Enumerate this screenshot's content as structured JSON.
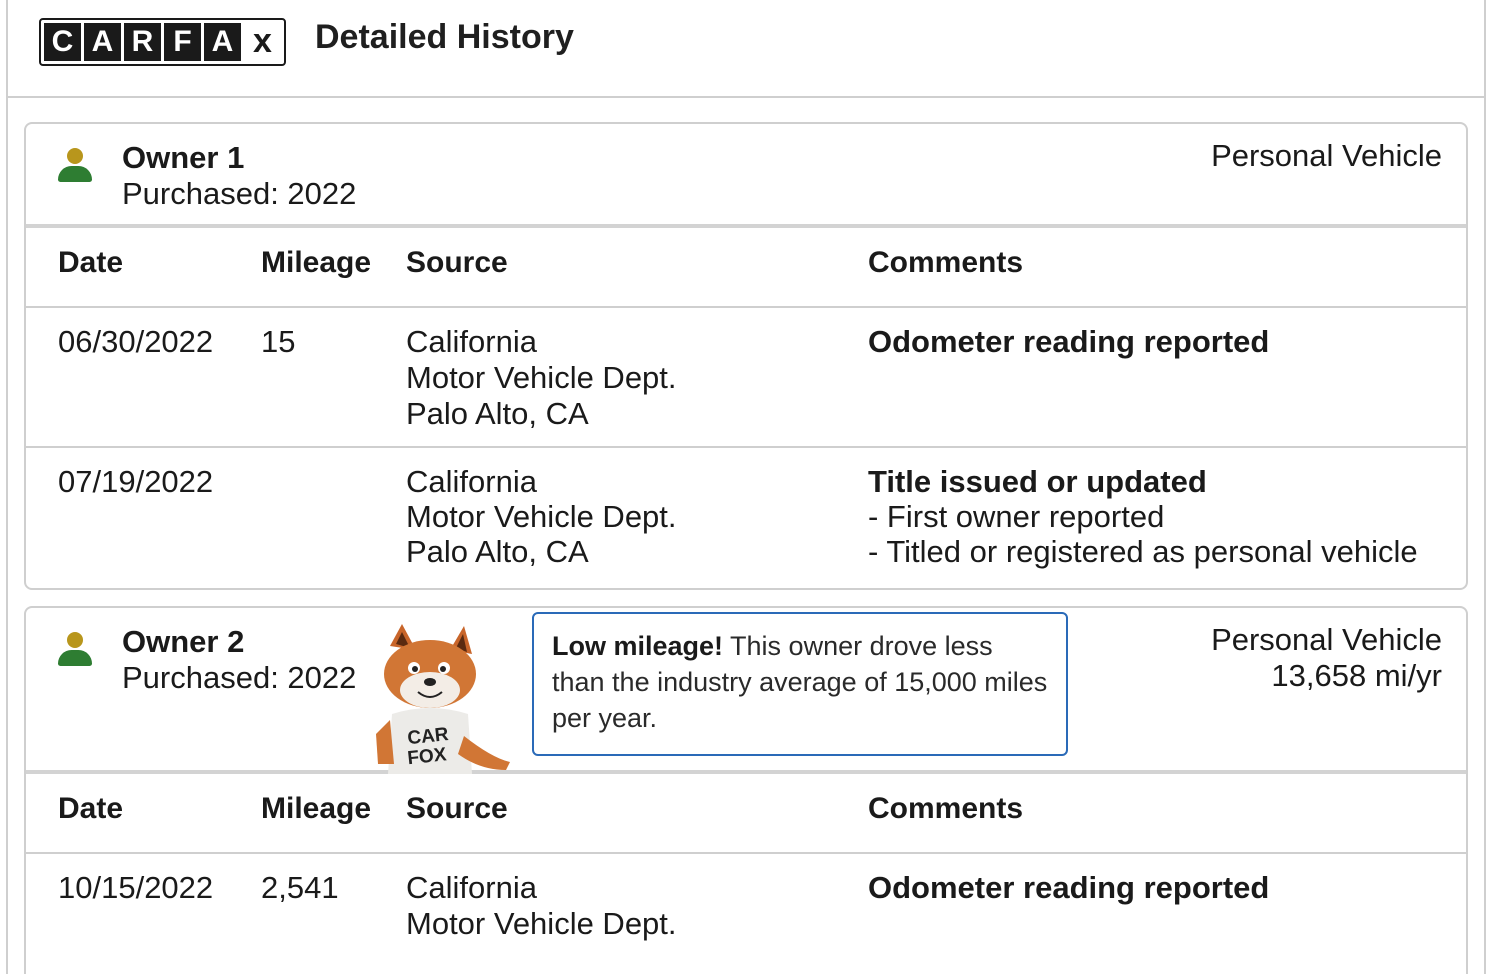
{
  "header": {
    "logo_letters": [
      "C",
      "A",
      "R",
      "F",
      "A",
      "x"
    ],
    "title": "Detailed History"
  },
  "columns": {
    "date": "Date",
    "mileage": "Mileage",
    "source": "Source",
    "comments": "Comments"
  },
  "owners": [
    {
      "name": "Owner 1",
      "purchased": "Purchased: 2022",
      "type": "Personal Vehicle",
      "rows": [
        {
          "date": "06/30/2022",
          "mileage": "15",
          "source": [
            "California",
            "Motor Vehicle Dept.",
            "Palo Alto, CA"
          ],
          "comment_title": "Odometer reading reported",
          "comment_items": []
        },
        {
          "date": "07/19/2022",
          "mileage": "",
          "source": [
            "California",
            "Motor Vehicle Dept.",
            "Palo Alto, CA"
          ],
          "comment_title": "Title issued or updated",
          "comment_items": [
            "- First owner reported",
            "- Titled or registered as personal vehicle"
          ]
        }
      ]
    },
    {
      "name": "Owner 2",
      "purchased": "Purchased: 2022",
      "type": "Personal Vehicle",
      "miles_per_year": "13,658 mi/yr",
      "callout": {
        "bold": "Low mileage!",
        "text": " This owner drove less than the industry average of 15,000 miles per year."
      },
      "mascot_shirt": "CAR FOX",
      "rows": [
        {
          "date": "10/15/2022",
          "mileage": "2,541",
          "source": [
            "California",
            "Motor Vehicle Dept."
          ],
          "comment_title": "Odometer reading reported",
          "comment_items": []
        }
      ]
    }
  ],
  "colors": {
    "icon_head": "#b8961c",
    "icon_body": "#2e7d32",
    "callout_border": "#2a6ab8"
  }
}
